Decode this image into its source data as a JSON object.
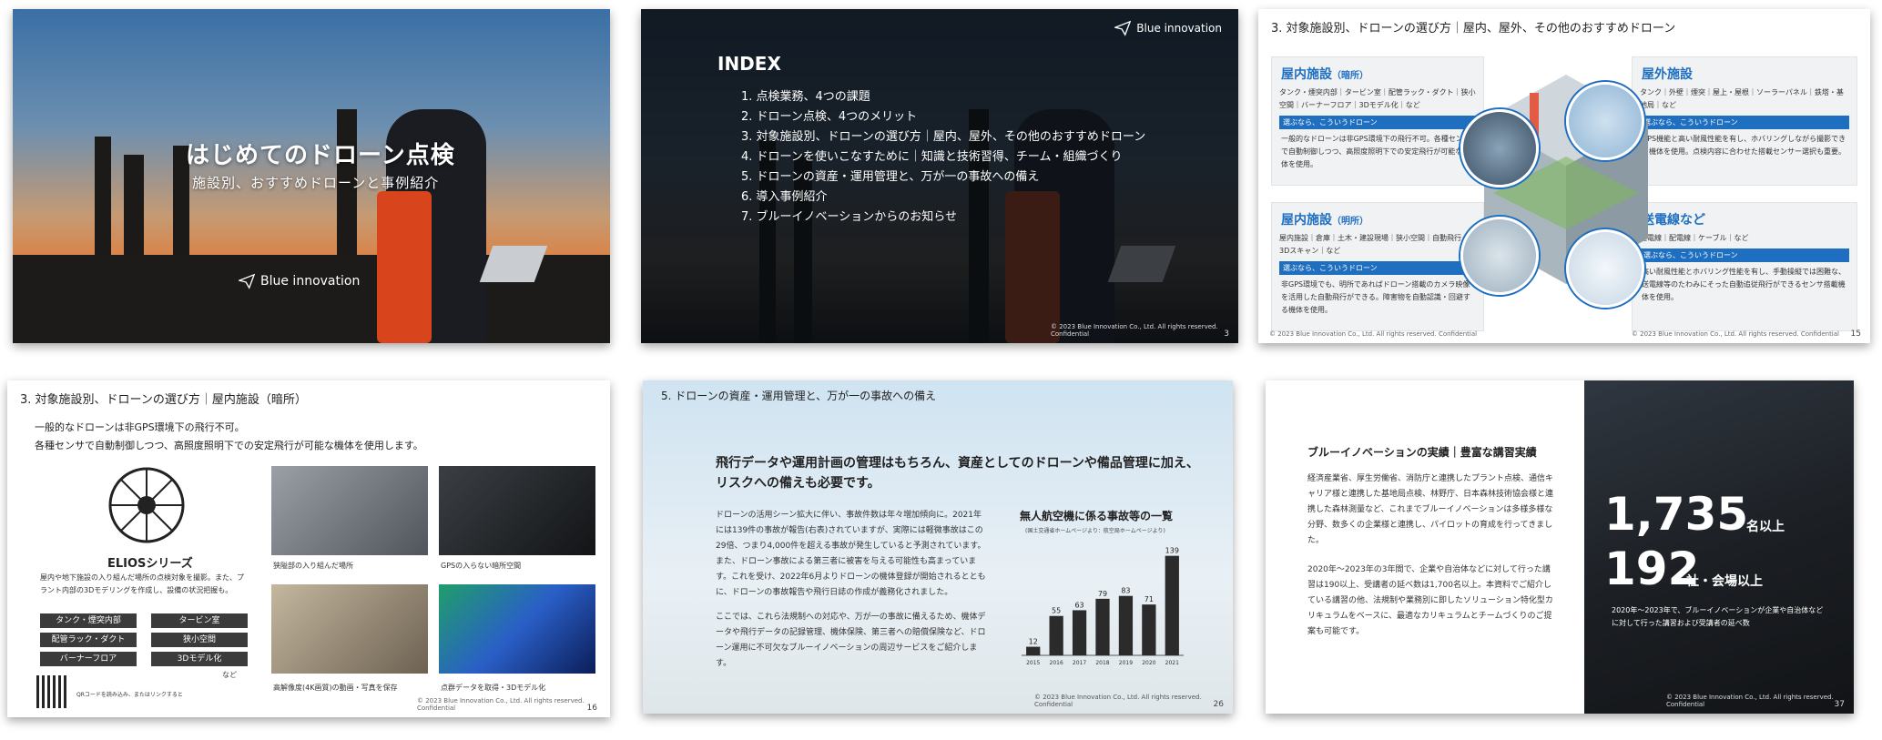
{
  "slide1": {
    "title": "はじめてのドローン点検",
    "subtitle": "施設別、おすすめドローンと事例紹介",
    "logo": "Blue innovation"
  },
  "slide2": {
    "logo": "Blue innovation",
    "index_title": "INDEX",
    "items": [
      "1.  点検業務、4つの課題",
      "2.  ドローン点検、4つのメリット",
      "3.  対象施設別、ドローンの選び方｜屋内、屋外、その他のおすすめドローン",
      "4.  ドローンを使いこなすために｜知識と技術習得、チーム・組織づくり",
      "5.  ドローンの資産・運用管理と、万が一の事故への備え",
      "6.  導入事例紹介",
      "7.  ブルーイノベーションからのお知らせ"
    ],
    "copyright": "© 2023 Blue Innovation Co., Ltd. All rights reserved.  Confidential",
    "page": "3"
  },
  "slide3": {
    "header": "3. 対象施設別、ドローンの選び方｜屋内、屋外、その他のおすすめドローン",
    "cards": [
      {
        "title": "屋内施設",
        "title_sub": "（暗所）",
        "tags": "タンク・煙突内部｜タービン室｜配管ラック・ダクト｜狭小空間｜バーナーフロア｜3Dモデル化｜など",
        "bar": "選ぶなら、こういうドローン",
        "desc": "一般的なドローンは非GPS環境下の飛行不可。各種センサで自動制御しつつ、高照度照明下での安定飛行が可能な機体を使用。"
      },
      {
        "title": "屋外施設",
        "title_sub": "",
        "tags": "タンク｜外壁｜煙突｜屋上・屋根｜ソーラーパネル｜鉄塔・基地局｜など",
        "bar": "選ぶなら、こういうドローン",
        "desc": "GPS機能と高い耐風性能を有し、ホバリングしながら撮影できる機体を使用。点検内容に合わせた搭載センサー選択も重要。"
      },
      {
        "title": "屋内施設",
        "title_sub": "（明所）",
        "tags": "屋内施設｜倉庫｜土木・建設現場｜狭小空間｜自動飛行｜3Dスキャン｜など",
        "bar": "選ぶなら、こういうドローン",
        "desc": "非GPS環境でも、明所であればドローン搭載のカメラ映像を活用した自動飛行ができる。障害物を自動認識・回避する機体を使用。"
      },
      {
        "title": "送電線など",
        "title_sub": "",
        "tags": "送電線｜配電線｜ケーブル｜など",
        "bar": "選ぶなら、こういうドローン",
        "desc": "高い耐風性能とホバリング性能を有し、手動操縦では困難な、送電線等のたわみにそった自動追従飛行ができるセンサ搭載機体を使用。"
      }
    ],
    "copyright": "© 2023 Blue Innovation Co., Ltd. All rights reserved.  Confidential",
    "page": "15"
  },
  "slide4": {
    "header": "3. 対象施設別、ドローンの選び方｜屋内施設（暗所）",
    "lead_1": "一般的なドローンは非GPS環境下の飛行不可。",
    "lead_2": "各種センサで自動制御しつつ、高照度照明下での安定飛行が可能な機体を使用します。",
    "product": "ELIOSシリーズ",
    "product_desc": "屋内や地下施設の入り組んだ場所の点検対象を撮影。また、プラント内部の3Dモデリングを作成し、設備の状況把握も。",
    "buttons": [
      "タンク・煙突内部",
      "タービン室",
      "配管ラック・ダクト",
      "狭小空間",
      "バーナーフロア",
      "3Dモデル化"
    ],
    "etc": "など",
    "captions": [
      "狭隘部の入り組んだ場所",
      "GPSの入らない暗所空間",
      "高解像度(4K画質)の動画・写真を保存",
      "点群データを取得・3Dモデル化"
    ],
    "qr_text": "QRコードを読み込み、またはリンクすると",
    "copyright": "© 2023 Blue Innovation Co., Ltd. All rights reserved.  Confidential",
    "page": "16"
  },
  "slide5": {
    "header": "5. ドローンの資産・運用管理と、万が一の事故への備え",
    "lead_1": "飛行データや運用計画の管理はもちろん、資産としてのドローンや備品管理に加え、",
    "lead_2": "リスクへの備えも必要です。",
    "body_1": "ドローンの活用シーン拡大に伴い、事故件数は年々増加傾向に。2021年には139件の事故が報告(右表)されていますが、実際には軽微事故はこの29倍、つまり4,000件を超える事故が発生していると予測されています。また、ドローン事故による第三者に被害を与える可能性も高まっています。これを受け、2022年6月よりドローンの機体登録が開始されるとともに、ドローンの事故報告や飛行日誌の作成が義務化されました。",
    "body_2": "ここでは、これら法規制への対応や、万が一の事故に備えるため、機体データや飛行データの記録管理、機体保険、第三者への賠償保険など、ドローン運用に不可欠なブルーイノベーションの周辺サービスをご紹介します。",
    "chart_title": "無人航空機に係る事故等の一覧",
    "chart_sub": "(国土交通省ホームページより：航空局ホームページより)",
    "copyright": "© 2023 Blue Innovation Co., Ltd. All rights reserved.  Confidential",
    "page": "26"
  },
  "chart_data": {
    "type": "bar",
    "title": "無人航空機に係る事故等の一覧",
    "categories": [
      "2015",
      "2016",
      "2017",
      "2018",
      "2019",
      "2020",
      "2021"
    ],
    "values": [
      12,
      55,
      63,
      79,
      83,
      71,
      139
    ],
    "ylim": [
      0,
      150
    ],
    "bar_color": "#2b2b2b"
  },
  "slide6": {
    "heading": "ブルーイノベーションの実績｜豊富な講習実績",
    "para_1": "経済産業省、厚生労働省、消防庁と連携したプラント点検、通信キャリア様と連携した基地局点検、林野庁、日本森林技術協会様と連携した森林測量など、これまでブルーイノベーションは多様多様な分野、数多くの企業様と連携し、パイロットの育成を行ってきました。",
    "para_2": "2020年～2023年の3年間で、企業や自治体などに対して行った講習は190以上、受講者の延べ数は1,700名以上。本資料でご紹介している講習の他、法規制や業務別に即したソリューション特化型カリキュラムをベースに、最適なカリキュラムとチームづくりのご提案も可能です。",
    "stat_1": "1,735",
    "stat_1_unit": "名以上",
    "stat_2": "192",
    "stat_2_unit": "社・会場以上",
    "note": "2020年～2023年で、ブルーイノベーションが企業や自治体などに対して行った講習および受講者の延べ数",
    "copyright": "© 2023 Blue Innovation Co., Ltd. All rights reserved.  Confidential",
    "page": "37"
  }
}
